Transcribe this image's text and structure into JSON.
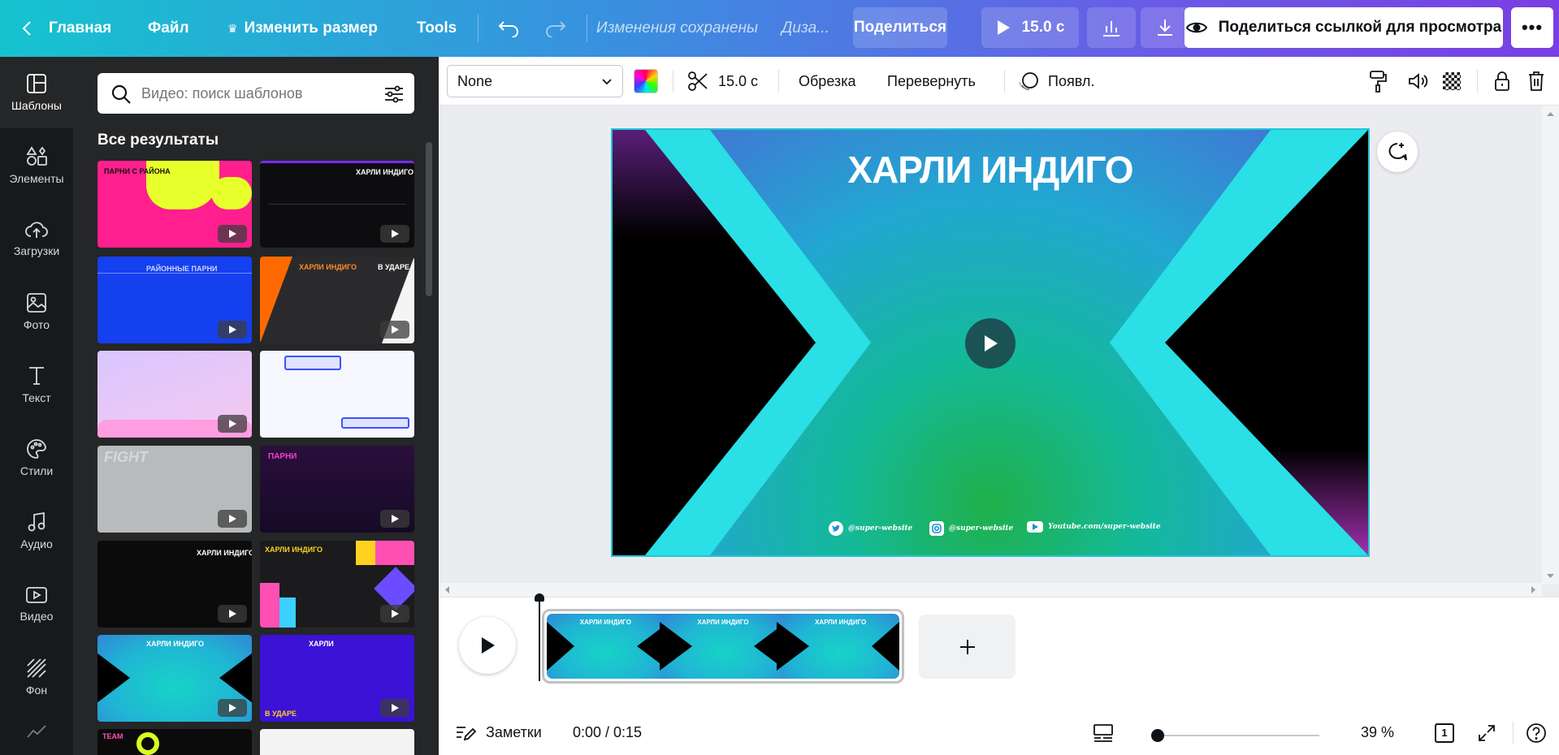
{
  "topbar": {
    "home_label": "Главная",
    "file_label": "Файл",
    "resize_label": "Изменить размер",
    "tools_label": "Tools",
    "save_status": "Изменения сохранены",
    "design_title": "Диза...",
    "share_label": "Поделиться",
    "duration_label": "15.0 с",
    "view_link_label": "Поделиться ссылкой для просмотра"
  },
  "rail": [
    {
      "label": "Шаблоны",
      "icon": "templates-icon",
      "active": true
    },
    {
      "label": "Элементы",
      "icon": "elements-icon"
    },
    {
      "label": "Загрузки",
      "icon": "upload-cloud-icon"
    },
    {
      "label": "Фото",
      "icon": "photo-icon"
    },
    {
      "label": "Текст",
      "icon": "text-icon"
    },
    {
      "label": "Стили",
      "icon": "palette-icon"
    },
    {
      "label": "Аудио",
      "icon": "music-note-icon"
    },
    {
      "label": "Видео",
      "icon": "video-icon"
    },
    {
      "label": "Фон",
      "icon": "background-icon"
    }
  ],
  "panel": {
    "search_placeholder": "Видео: поиск шаблонов",
    "results_title": "Все результаты",
    "thumbnails": [
      {
        "caption": "ПАРНИ С РАЙОНА"
      },
      {
        "caption": "ХАРЛИ ИНДИГО"
      },
      {
        "caption": "РАЙОННЫЕ ПАРНИ"
      },
      {
        "caption": "ХАРЛИ ИНДИГО",
        "caption2": "В УДАРЕ"
      },
      {
        "caption": ""
      },
      {
        "caption": ""
      },
      {
        "caption": "FIGHT"
      },
      {
        "caption": "ПАРНИ"
      },
      {
        "caption": "ХАРЛИ ИНДИГО"
      },
      {
        "caption": "ХАРЛИ ИНДИГО"
      },
      {
        "caption": "ХАРЛИ ИНДИГО"
      },
      {
        "caption": "ХАРЛИ",
        "caption2": "В УДАРЕ"
      },
      {
        "caption": "TEAM"
      },
      {
        "caption": ""
      }
    ]
  },
  "context_toolbar": {
    "font_value": "None",
    "duration_label": "15.0 с",
    "crop_label": "Обрезка",
    "flip_label": "Перевернуть",
    "animate_label": "Появл."
  },
  "slide": {
    "title": "ХАРЛИ ИНДИГО",
    "socials": [
      {
        "icon": "twitter-icon",
        "text": "@super-website"
      },
      {
        "icon": "instagram-icon",
        "text": "@super-website"
      },
      {
        "icon": "youtube-icon",
        "text": "Youtube.com/super-website"
      }
    ]
  },
  "timeline": {
    "clip_frame_text": "ХАРЛИ ИНДИГО"
  },
  "bottom": {
    "notes_label": "Заметки",
    "time_label": "0:00 / 0:15",
    "zoom_label": "39 %",
    "page_count": "1"
  }
}
